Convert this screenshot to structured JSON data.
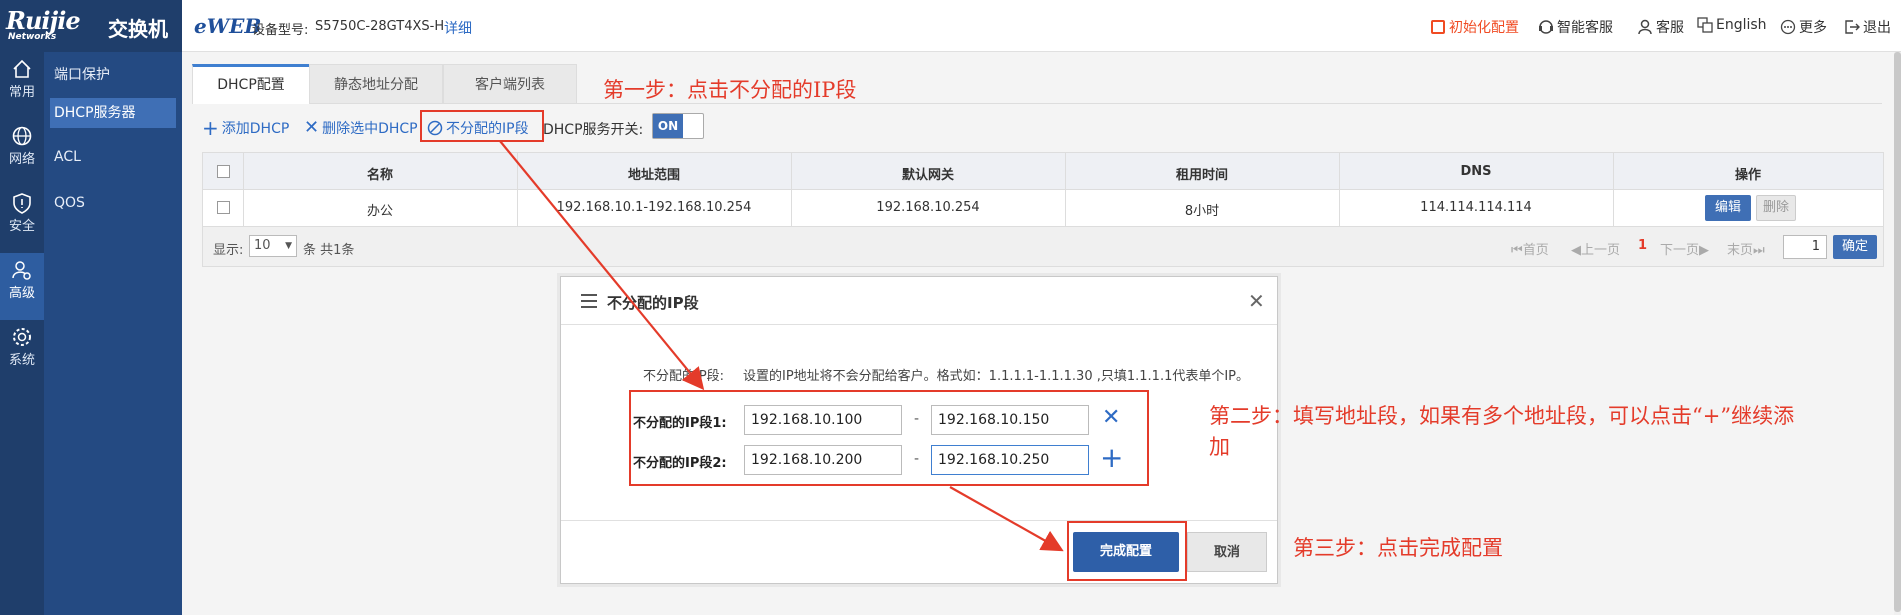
{
  "brand": {
    "logo": "Ruijie",
    "logo_sub": "Networks",
    "product": "交换机"
  },
  "header": {
    "eweb": "eWEB",
    "device_label": "设备型号:",
    "device_model": "S5750C-28GT4XS-H",
    "detail_link": "详细",
    "actions": {
      "init": "初始化配置",
      "smart": "智能客服",
      "service": "客服",
      "lang": "English",
      "more": "更多",
      "logout": "退出"
    },
    "accent": "#f04b23"
  },
  "rail": [
    {
      "label": "常用",
      "icon": "home-icon"
    },
    {
      "label": "网络",
      "icon": "globe-icon"
    },
    {
      "label": "安全",
      "icon": "shield-icon"
    },
    {
      "label": "高级",
      "icon": "users-gear-icon",
      "active": true
    },
    {
      "label": "系统",
      "icon": "gear-icon"
    }
  ],
  "submenu": [
    {
      "label": "端口保护"
    },
    {
      "label": "DHCP服务器",
      "active": true
    },
    {
      "label": "ACL"
    },
    {
      "label": "QOS"
    }
  ],
  "tabs": [
    {
      "label": "DHCP配置",
      "active": true
    },
    {
      "label": "静态地址分配"
    },
    {
      "label": "客户端列表"
    }
  ],
  "toolbar": {
    "add": "添加DHCP",
    "delete": "删除选中DHCP",
    "excluded": "不分配的IP段",
    "switch_label": "DHCP服务开关:",
    "switch_value": "ON"
  },
  "table": {
    "headers": [
      "名称",
      "地址范围",
      "默认网关",
      "租用时间",
      "DNS",
      "操作"
    ],
    "rows": [
      {
        "name": "办公",
        "range": "192.168.10.1-192.168.10.254",
        "gateway": "192.168.10.254",
        "lease": "8小时",
        "dns": "114.114.114.114",
        "edit": "编辑",
        "del": "删除"
      }
    ]
  },
  "pagination": {
    "show": "显示:",
    "page_size": "10",
    "count_text": "条 共1条",
    "first": "首页",
    "prev": "上一页",
    "current": "1",
    "next": "下一页",
    "last": "末页",
    "goto": "1",
    "confirm": "确定"
  },
  "dialog": {
    "title": "不分配的IP段",
    "hint_label": "不分配的IP段:",
    "hint_text": "设置的IP地址将不会分配给客户。格式如：1.1.1.1-1.1.1.30 ,只填1.1.1.1代表单个IP。",
    "rows": [
      {
        "label": "不分配的IP段1:",
        "start": "192.168.10.100",
        "end": "192.168.10.150"
      },
      {
        "label": "不分配的IP段2:",
        "start": "192.168.10.200",
        "end": "192.168.10.250"
      }
    ],
    "dash": "-",
    "ok": "完成配置",
    "cancel": "取消"
  },
  "annotations": {
    "step1": "第一步：点击不分配的IP段",
    "step2_a": "第二步：填写地址段，如果有多个地址段，可以点击“+”继续添",
    "step2_b": "加",
    "step3": "第三步：点击完成配置"
  }
}
